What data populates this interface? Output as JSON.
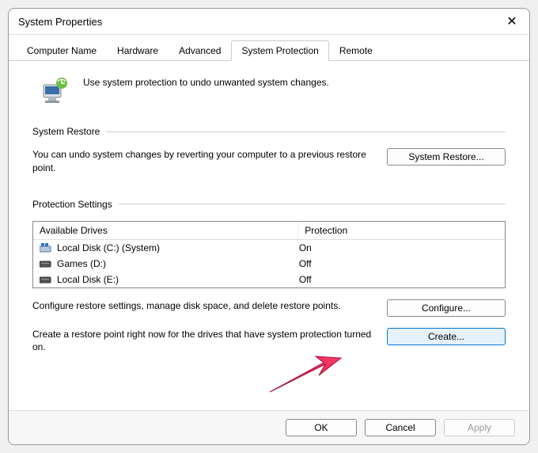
{
  "window": {
    "title": "System Properties"
  },
  "tabs": {
    "computer_name": "Computer Name",
    "hardware": "Hardware",
    "advanced": "Advanced",
    "system_protection": "System Protection",
    "remote": "Remote"
  },
  "intro": {
    "text": "Use system protection to undo unwanted system changes."
  },
  "restore": {
    "section_title": "System Restore",
    "text": "You can undo system changes by reverting your computer to a previous restore point.",
    "button": "System Restore..."
  },
  "protection": {
    "section_title": "Protection Settings",
    "col_drive": "Available Drives",
    "col_protection": "Protection",
    "drives": [
      {
        "name": "Local Disk (C:) (System)",
        "status": "On",
        "icon": "system"
      },
      {
        "name": "Games (D:)",
        "status": "Off",
        "icon": "disk"
      },
      {
        "name": "Local Disk (E:)",
        "status": "Off",
        "icon": "disk"
      }
    ],
    "configure_text": "Configure restore settings, manage disk space, and delete restore points.",
    "configure_button": "Configure...",
    "create_text": "Create a restore point right now for the drives that have system protection turned on.",
    "create_button": "Create..."
  },
  "footer": {
    "ok": "OK",
    "cancel": "Cancel",
    "apply": "Apply"
  }
}
